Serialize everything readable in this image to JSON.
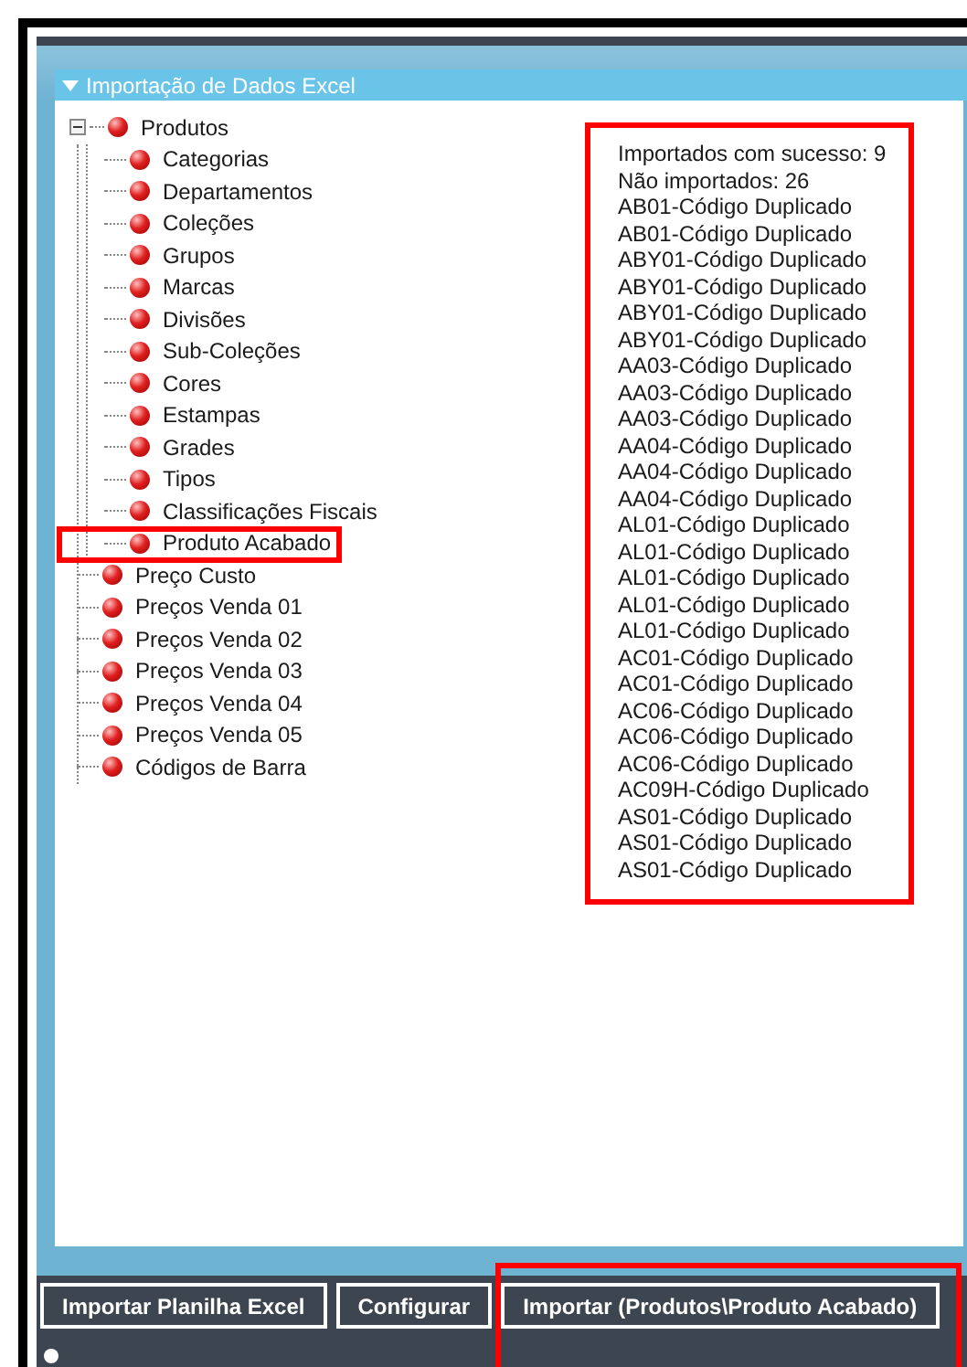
{
  "panel": {
    "title": "Importação de Dados Excel",
    "expanded": true
  },
  "tree": [
    {
      "label": "Produtos",
      "expanded": true,
      "annotated": false,
      "children": [
        {
          "label": "Categorias",
          "annotated": false
        },
        {
          "label": "Departamentos",
          "annotated": false
        },
        {
          "label": "Coleções",
          "annotated": false
        },
        {
          "label": "Grupos",
          "annotated": false
        },
        {
          "label": "Marcas",
          "annotated": false
        },
        {
          "label": "Divisões",
          "annotated": false
        },
        {
          "label": "Sub-Coleções",
          "annotated": false
        },
        {
          "label": "Cores",
          "annotated": false
        },
        {
          "label": "Estampas",
          "annotated": false
        },
        {
          "label": "Grades",
          "annotated": false
        },
        {
          "label": "Tipos",
          "annotated": false
        },
        {
          "label": "Classificações Fiscais",
          "annotated": false
        },
        {
          "label": "Produto Acabado",
          "annotated": true
        }
      ]
    },
    {
      "label": "Preço Custo",
      "annotated": false
    },
    {
      "label": "Preços Venda 01",
      "annotated": false
    },
    {
      "label": "Preços Venda 02",
      "annotated": false
    },
    {
      "label": "Preços Venda 03",
      "annotated": false
    },
    {
      "label": "Preços Venda 04",
      "annotated": false
    },
    {
      "label": "Preços Venda 05",
      "annotated": false
    },
    {
      "label": "Códigos de Barra",
      "annotated": false
    }
  ],
  "results": {
    "annotated": true,
    "lines": [
      "Importados com sucesso: 9",
      "Não importados: 26",
      "AB01-Código Duplicado",
      "AB01-Código Duplicado",
      "ABY01-Código Duplicado",
      "ABY01-Código Duplicado",
      "ABY01-Código Duplicado",
      "ABY01-Código Duplicado",
      "AA03-Código Duplicado",
      "AA03-Código Duplicado",
      "AA03-Código Duplicado",
      "AA04-Código Duplicado",
      "AA04-Código Duplicado",
      "AA04-Código Duplicado",
      "AL01-Código Duplicado",
      "AL01-Código Duplicado",
      "AL01-Código Duplicado",
      "AL01-Código Duplicado",
      "AL01-Código Duplicado",
      "AC01-Código Duplicado",
      "AC01-Código Duplicado",
      "AC06-Código Duplicado",
      "AC06-Código Duplicado",
      "AC06-Código Duplicado",
      "AC09H-Código Duplicado",
      "AS01-Código Duplicado",
      "AS01-Código Duplicado",
      "AS01-Código Duplicado"
    ]
  },
  "buttons": [
    {
      "label": "Importar Planilha Excel",
      "annotated": false
    },
    {
      "label": "Configurar",
      "annotated": false
    },
    {
      "label": "Importar (Produtos\\Produto Acabado)",
      "annotated": true
    }
  ]
}
